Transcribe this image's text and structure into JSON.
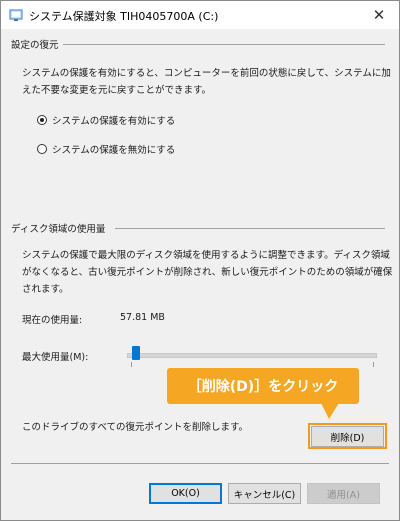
{
  "window": {
    "title": "システム保護対象 TIH0405700A (C:)",
    "close_glyph": "✕"
  },
  "restore_settings": {
    "group_label": "設定の復元",
    "description_line1": "システムの保護を有効にすると、コンピューターを前回の状態に戻して、システムに加",
    "description_line2": "えた不要な変更を元に戻すことができます。",
    "options": [
      {
        "label": "システムの保護を有効にする",
        "selected": true
      },
      {
        "label": "システムの保護を無効にする",
        "selected": false
      }
    ]
  },
  "disk_usage": {
    "group_label": "ディスク領域の使用量",
    "description_line1": "システムの保護で最大限のディスク領域を使用するように調整できます。ディスク領域",
    "description_line2": "がなくなると、古い復元ポイントが削除され、新しい復元ポイントのための領域が確保",
    "description_line3": "されます。",
    "current_usage_label": "現在の使用量:",
    "current_usage_value": "57.81 MB",
    "max_usage_label": "最大使用量(M):",
    "max_usage_fraction": 0.02,
    "delete_description": "このドライブのすべての復元ポイントを削除します。",
    "delete_button": "削除(D)"
  },
  "annotation": {
    "callout_text": "［削除(D)］をクリック",
    "highlight_color": "#f39a1e",
    "callout_color": "#f5a623"
  },
  "footer": {
    "ok_button": "OK(O)",
    "cancel_button": "キャンセル(C)",
    "apply_button": "適用(A)"
  }
}
